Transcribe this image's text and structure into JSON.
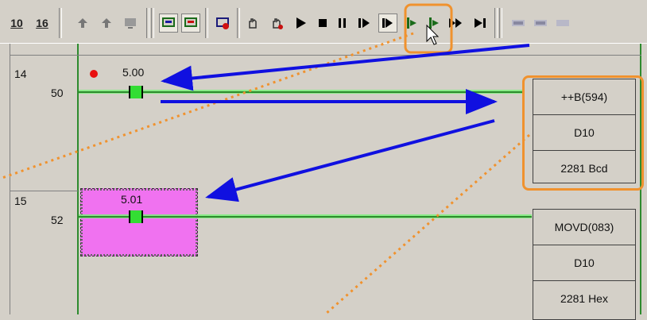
{
  "toolbar": {
    "num_a": "10",
    "num_b": "16",
    "buttons": [
      "decimal-display-icon",
      "hex-display-icon",
      "step-out-icon",
      "step-in-icon",
      "monitor-icon",
      "online-edit-icon",
      "transfer-icon",
      "force-icon",
      "hand-icon",
      "set-reset-icon",
      "run-icon",
      "stop-icon",
      "pause-icon",
      "single-step-icon",
      "step-into-icon",
      "step-back-icon",
      "continuous-step-icon",
      "skip-icon",
      "watch-icon",
      "watch2-icon"
    ]
  },
  "rungs": [
    {
      "number": "14",
      "address": "50",
      "contact": "5.00",
      "function_box": [
        "++B(594)",
        "D10",
        "2281 Bcd"
      ]
    },
    {
      "number": "15",
      "address": "52",
      "contact": "5.01",
      "function_box": [
        "MOVD(083)",
        "D10",
        "2281 Hex"
      ]
    }
  ],
  "colors": {
    "accent": "#f0922e",
    "arrow": "#1010e0",
    "rung_line": "#2e8b2e",
    "contact_on": "#33dd33",
    "selection": "#f072f0",
    "force_dot": "#e81010"
  }
}
